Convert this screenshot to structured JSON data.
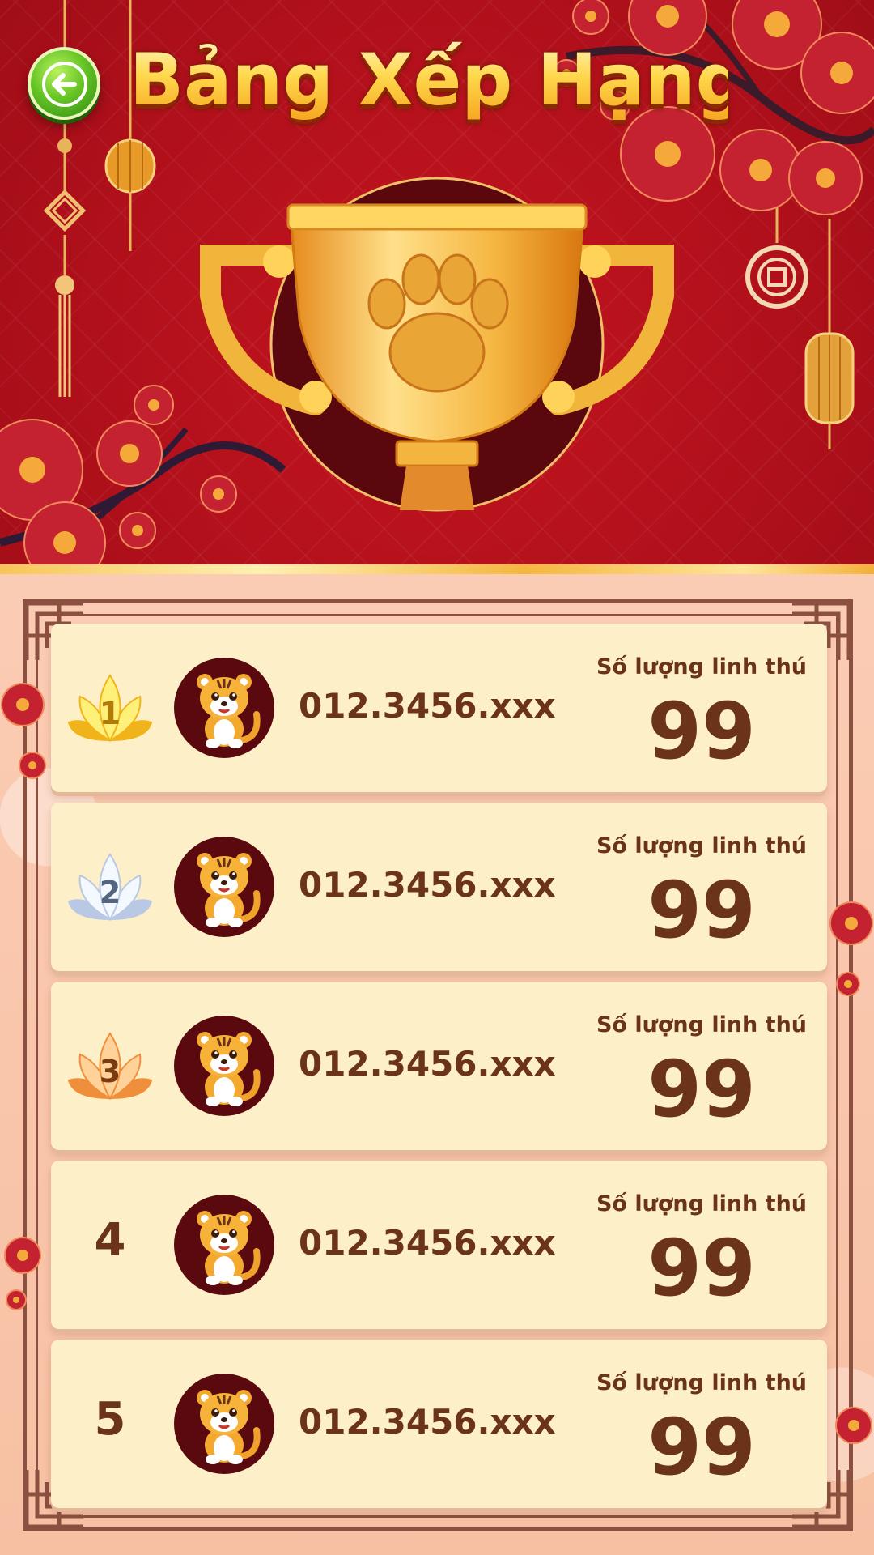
{
  "header": {
    "title": "Bảng Xếp Hạng",
    "back_icon": "arrow-left-icon",
    "trophy_icon": "trophy-paw-icon"
  },
  "colors": {
    "header_red": "#b0101b",
    "accent_gold": "#ffd84d",
    "row_bg": "#fdefc7",
    "text_brown": "#6b3418",
    "frame_brown": "#8b5040",
    "back_green": "#66c425"
  },
  "leaderboard": {
    "rows": [
      {
        "rank": "1",
        "badge": "gold-lotus-icon",
        "phone": "012.3456.xxx",
        "count_label": "Số lượng linh thú",
        "count": "99"
      },
      {
        "rank": "2",
        "badge": "silver-lotus-icon",
        "phone": "012.3456.xxx",
        "count_label": "Số lượng linh thú",
        "count": "99"
      },
      {
        "rank": "3",
        "badge": "bronze-lotus-icon",
        "phone": "012.3456.xxx",
        "count_label": "Số lượng linh thú",
        "count": "99"
      },
      {
        "rank": "4",
        "badge": "",
        "phone": "012.3456.xxx",
        "count_label": "Số lượng linh thú",
        "count": "99"
      },
      {
        "rank": "5",
        "badge": "",
        "phone": "012.3456.xxx",
        "count_label": "Số lượng linh thú",
        "count": "99"
      }
    ]
  }
}
